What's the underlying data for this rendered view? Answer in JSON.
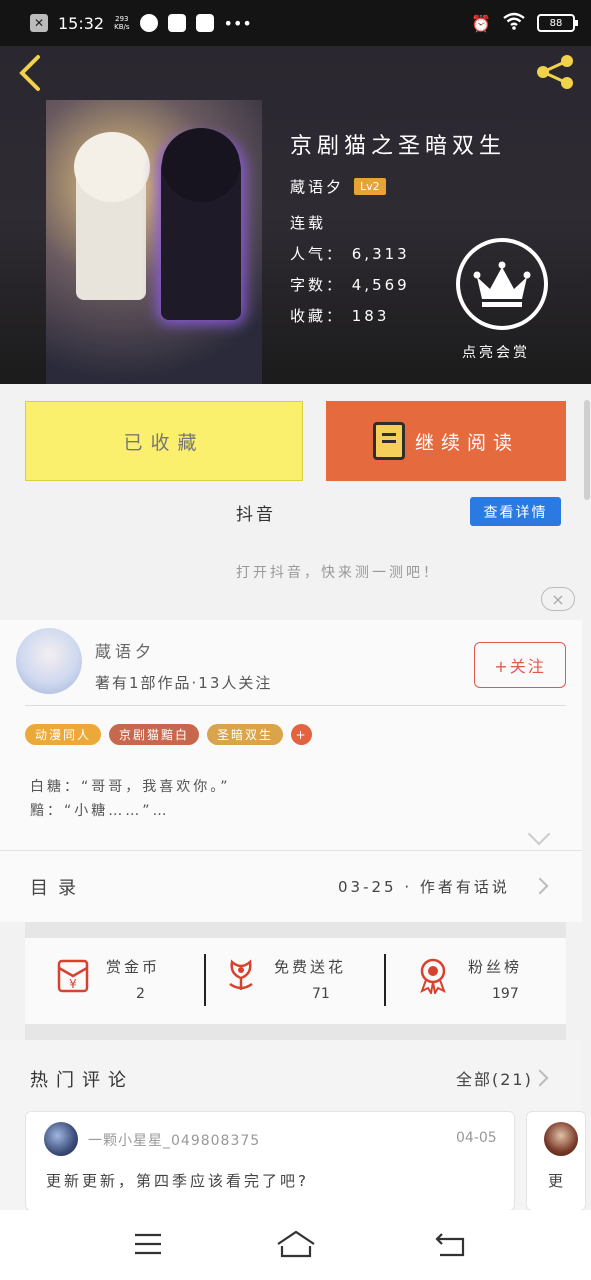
{
  "status_bar": {
    "time": "15:32",
    "speed_value": "293",
    "speed_unit": "KB/s",
    "more": "•••",
    "battery": "88"
  },
  "book": {
    "title": "京剧猫之圣暗双生",
    "author": "蔵语夕",
    "level": "Lv2",
    "status": "连载",
    "popularity": "人气： 6,313",
    "word_count": "字数： 4,569",
    "collections": "收藏： 183",
    "reward_label": "点亮会赏"
  },
  "actions": {
    "collected_label": "已收藏",
    "continue_label": "继续阅读"
  },
  "douyin": {
    "title": "抖音",
    "detail_button": "查看详情",
    "hint": "打开抖音，快来测一测吧！",
    "close": "×"
  },
  "author_card": {
    "name": "蔵语夕",
    "stats": "著有1部作品·13人关注",
    "follow_button": "+关注",
    "tags": [
      {
        "label": "动漫同人",
        "color": "#eda83a"
      },
      {
        "label": "京剧猫黯白",
        "color": "#c7684e"
      },
      {
        "label": "圣暗双生",
        "color": "#d9a44a"
      },
      {
        "label": "+",
        "color": "#e4623f"
      }
    ],
    "blurb_line1": "白糖：“哥哥，我喜欢你。”",
    "blurb_line2": "黯：“小糖……”…"
  },
  "catalog": {
    "label": "目录",
    "info": "03-25 · 作者有话说"
  },
  "stats": [
    {
      "label": "赏金币",
      "value": "2",
      "icon": "gold-coin-icon"
    },
    {
      "label": "免费送花",
      "value": "71",
      "icon": "flower-icon"
    },
    {
      "label": "粉丝榜",
      "value": "197",
      "icon": "medal-icon"
    }
  ],
  "comments": {
    "title": "热门评论",
    "all_label": "全部(21)",
    "items": [
      {
        "user": "一颗小星星_049808375",
        "date": "04-05",
        "text": "更新更新，第四季应该看完了吧?"
      },
      {
        "user": "",
        "date": "",
        "text": "更"
      }
    ]
  },
  "colors": {
    "accent_yellow": "#faf06e",
    "accent_orange": "#e56a3e",
    "link_blue": "#2a7ae2",
    "follow_red": "#e05a4a"
  }
}
